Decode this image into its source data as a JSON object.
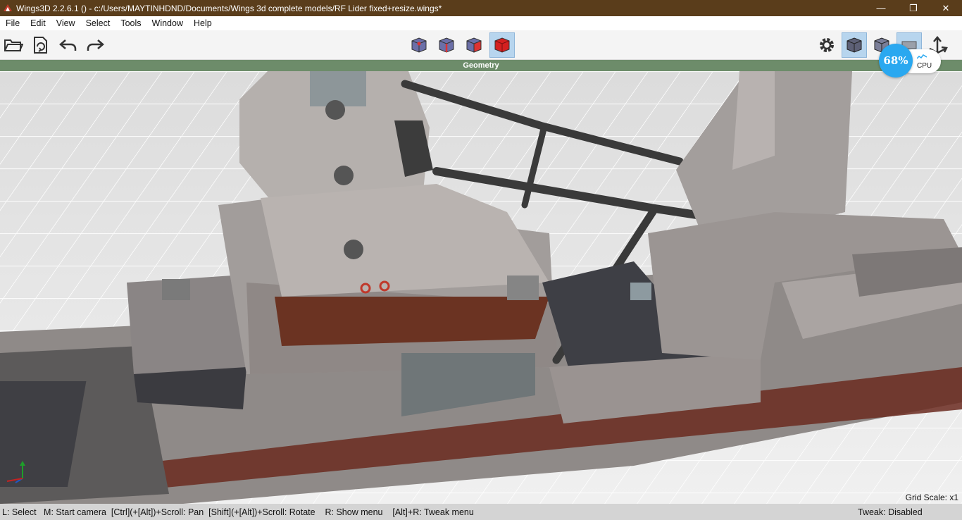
{
  "window": {
    "title": "Wings3D 2.2.6.1 () - c:/Users/MAYTINHDND/Documents/Wings 3d complete models/RF Lider fixed+resize.wings*",
    "minimize_glyph": "—",
    "maximize_glyph": "❐",
    "close_glyph": "✕"
  },
  "menu": [
    "File",
    "Edit",
    "View",
    "Select",
    "Tools",
    "Window",
    "Help"
  ],
  "toolbar": {
    "left_icons": [
      "open-folder-icon",
      "save-icon",
      "undo-icon",
      "redo-icon"
    ],
    "mode_icons": [
      "vertex-mode-icon",
      "edge-mode-icon",
      "face-mode-icon",
      "body-mode-icon"
    ],
    "active_mode": "body",
    "right_icons": [
      "settings-gear-icon",
      "smooth-shade-icon",
      "wireframe-shade-icon",
      "ground-plane-icon",
      "axes-icon"
    ]
  },
  "geometry_bar": {
    "label": "Geometry",
    "color": "#6d8c6a"
  },
  "cpu_widget": {
    "percent": "68%",
    "label": "CPU"
  },
  "viewport": {
    "grid_scale": "Grid Scale: x1"
  },
  "status": {
    "hint": "L: Select   M: Start camera  [Ctrl](+[Alt])+Scroll: Pan  [Shift](+[Alt])+Scroll: Rotate    R: Show menu    [Alt]+R: Tweak menu",
    "tweak": "Tweak: Disabled"
  },
  "colors": {
    "titlebar": "#5a3d1b",
    "accent": "#2aa8f0",
    "active_mode_bg": "#b7d5ee"
  }
}
